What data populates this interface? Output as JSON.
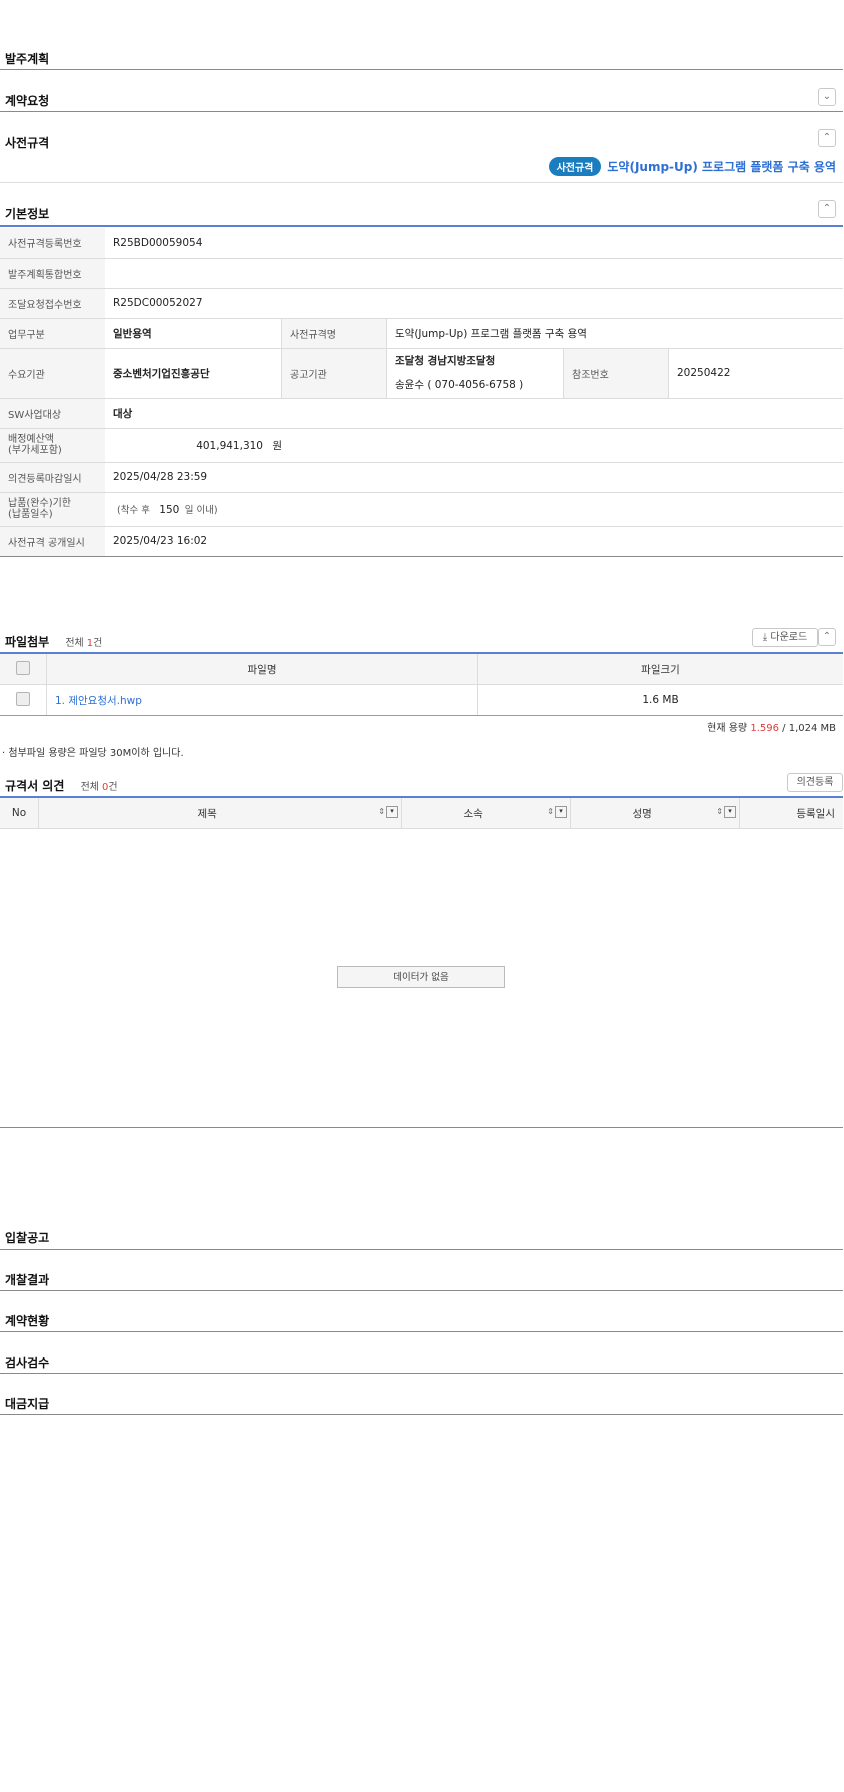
{
  "sections_top": {
    "order_plan": "발주계획",
    "contract_request": "계약요청",
    "pre_spec": "사전규격"
  },
  "pre_spec_badge": {
    "badge": "사전규격",
    "title": "도약(Jump-Up) 프로그램 플랫폼 구축 용역"
  },
  "basic_info": {
    "title": "기본정보",
    "reg_no_label": "사전규격등록번호",
    "reg_no": "R25BD00059054",
    "plan_no_label": "발주계획통합번호",
    "plan_no": "",
    "proc_no_label": "조달요청접수번호",
    "proc_no": "R25DC00052027",
    "biz_type_label": "업무구분",
    "biz_type": "일반용역",
    "spec_name_label": "사전규격명",
    "spec_name": "도약(Jump-Up) 프로그램 플랫폼 구축 용역",
    "demand_label": "수요기관",
    "demand": "중소벤처기업진흥공단",
    "notice_org_label": "공고기관",
    "notice_org_line1": "조달청 경남지방조달청",
    "notice_org_line2": "송윤수 ( 070-4056-6758 )",
    "ref_no_label": "참조번호",
    "ref_no": "20250422",
    "sw_label": "SW사업대상",
    "sw": "대상",
    "budget_label_1": "배정예산액",
    "budget_label_2": "(부가세포함)",
    "budget": "401,941,310",
    "budget_unit": "원",
    "deadline_label": "의견등록마감일시",
    "deadline": "2025/04/28 23:59",
    "delivery_label_1": "납품(완수)기한",
    "delivery_label_2": "(납품일수)",
    "delivery_prefix": "(착수 후",
    "delivery_days": "150",
    "delivery_suffix": "일 이내)",
    "open_date_label": "사전규격 공개일시",
    "open_date": "2025/04/23 16:02"
  },
  "attachments": {
    "title": "파일첨부",
    "total_label": "전체",
    "total_count": "1",
    "total_unit": "건",
    "download_btn": "다운로드",
    "col_name": "파일명",
    "col_size": "파일크기",
    "rows": [
      {
        "name": "1. 제안요청서.hwp",
        "size": "1.6 MB"
      }
    ],
    "usage_label": "현재 용량",
    "usage_value": "1.596",
    "usage_max": "/ 1,024 MB",
    "notice": "첨부파일 용량은 파일당 30M이하 입니다."
  },
  "opinions": {
    "title": "규격서 의견",
    "total_label": "전체",
    "total_count": "0",
    "total_unit": "건",
    "register_btn": "의견등록",
    "col_no": "No",
    "col_subject": "제목",
    "col_dept": "소속",
    "col_name": "성명",
    "col_date": "등록일시",
    "empty": "데이터가 없음"
  },
  "sections_bottom": {
    "bid_notice": "입찰공고",
    "opening_result": "개찰결과",
    "contract_status": "계약현황",
    "inspection": "검사검수",
    "payment": "대금지급"
  },
  "colors": {
    "badge_bg": "#1a7dbf",
    "link_blue": "#2e6fd4",
    "count_red": "#e03b3b",
    "header_blue_line": "#5b7fd1"
  }
}
